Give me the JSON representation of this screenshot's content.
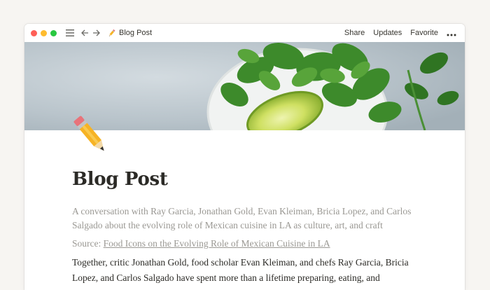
{
  "titlebar": {
    "breadcrumb_title": "Blog Post",
    "actions": {
      "share": "Share",
      "updates": "Updates",
      "favorite": "Favorite"
    }
  },
  "icons": {
    "menu": "hamburger-menu-icon",
    "back": "arrow-left-icon",
    "forward": "arrow-right-icon",
    "page": "pencil-icon",
    "more": "more-horizontal-icon"
  },
  "page": {
    "title": "Blog Post",
    "subtitle": "A conversation with Ray Garcia, Jonathan Gold, Evan Kleiman, Bricia Lopez, and Carlos Salgado about the evolving role of Mexican cuisine in LA as culture, art, and craft",
    "source_prefix": "Source:",
    "source_link": "Food Icons on the Evolving Role of Mexican Cuisine in LA",
    "body": "Together, critic Jonathan Gold, food scholar Evan Kleiman, and chefs Ray Garcia, Bricia Lopez, and Carlos Salgado have spent more than a lifetime preparing, eating, and"
  },
  "colors": {
    "close": "#fe5f57",
    "minimize": "#febc2e",
    "zoom": "#28c840",
    "title_text": "#2b2a26",
    "muted_text": "#9a9893"
  }
}
